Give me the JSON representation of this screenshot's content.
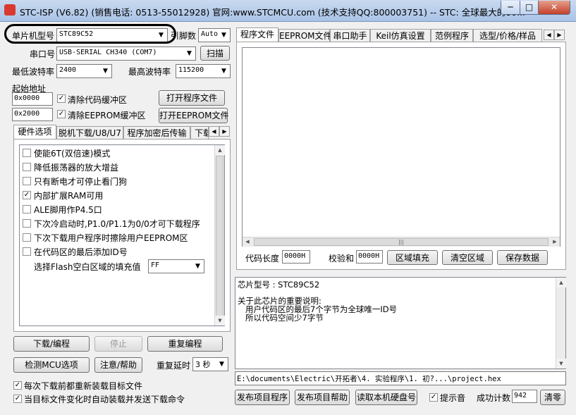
{
  "window": {
    "title": "STC-ISP (V6.82) (销售电话: 0513-55012928) 官网:www.STCMCU.com  (技术支持QQ:800003751)  -- STC: 全球最大的80..."
  },
  "mcu": {
    "label": "单片机型号",
    "value": "STC89C52",
    "pins_label": "引脚数",
    "pins_value": "Auto"
  },
  "port": {
    "label": "串口号",
    "value": "USB-SERIAL CH340 (COM7)",
    "scan_button": "扫描"
  },
  "baud": {
    "min_label": "最低波特率",
    "min_value": "2400",
    "max_label": "最高波特率",
    "max_value": "115200"
  },
  "start_address": {
    "label": "起始地址",
    "code_value": "0x0000",
    "clear_code_label": "清除代码缓冲区",
    "clear_code_checked": true,
    "eeprom_value": "0x2000",
    "clear_eeprom_label": "清除EEPROM缓冲区",
    "clear_eeprom_checked": true,
    "open_program_button": "打开程序文件",
    "open_eeprom_button": "打开EEPROM文件"
  },
  "left_tabs": [
    "硬件选项",
    "脱机下载/U8/U7",
    "程序加密后传输",
    "下载"
  ],
  "hw_options": [
    {
      "label": "使能6T(双倍速)模式",
      "checked": false
    },
    {
      "label": "降低振荡器的放大增益",
      "checked": false
    },
    {
      "label": "只有断电才可停止看门狗",
      "checked": false
    },
    {
      "label": "内部扩展RAM可用",
      "checked": true
    },
    {
      "label": "ALE脚用作P4.5口",
      "checked": false
    },
    {
      "label": "下次冷启动时,P1.0/P1.1为0/0才可下载程序",
      "checked": false
    },
    {
      "label": "下次下载用户程序时擦除用户EEPROM区",
      "checked": false
    },
    {
      "label": "在代码区的最后添加ID号",
      "checked": false
    }
  ],
  "fill": {
    "label": "选择Flash空白区域的填充值",
    "value": "FF"
  },
  "actions": {
    "download": "下载/编程",
    "stop": "停止",
    "reprogram": "重复编程",
    "check_mcu": "检测MCU选项",
    "help": "注意/帮助",
    "delay_label": "重复延时",
    "delay_value": "3 秒"
  },
  "bottom_checks": [
    {
      "label": "每次下载前都重新装载目标文件",
      "checked": true
    },
    {
      "label": "当目标文件变化时自动装载并发送下载命令",
      "checked": true
    }
  ],
  "right_tabs": [
    "程序文件",
    "EEPROM文件",
    "串口助手",
    "Keil仿真设置",
    "范例程序",
    "选型/价格/样品"
  ],
  "code_info": {
    "length_label": "代码长度",
    "length_value": "0000H",
    "checksum_label": "校验和",
    "checksum_value": "0000H",
    "fill_button": "区域填充",
    "clear_button": "清空区域",
    "save_button": "保存数据"
  },
  "info_text": {
    "line1": "芯片型号 : STC89C52",
    "line2": "关于此芯片的重要说明:",
    "line3": "用户代码区的最后7个字节为全球唯一ID号",
    "line4": "所以代码空间少7字节"
  },
  "path": "E:\\documents\\Electric\\开拓者\\4. 实验程序\\1. 初?...\\project.hex",
  "bottom_bar": {
    "publish_program": "发布项目程序",
    "publish_help": "发布项目帮助",
    "read_disk": "读取本机硬盘号",
    "sound_label": "提示音",
    "sound_checked": true,
    "success_label": "成功计数",
    "success_value": "942",
    "clear_button": "清零"
  },
  "colors": {
    "titlebar": "#b7cdeb",
    "close": "#c4412b",
    "window_bg": "#f0f0f0"
  }
}
